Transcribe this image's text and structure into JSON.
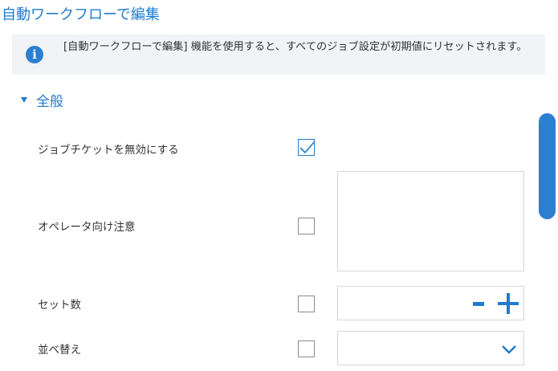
{
  "header": {
    "title": "自動ワークフローで編集"
  },
  "info": {
    "icon": "info-icon",
    "glyph": "i",
    "message": "[自動ワークフローで編集] 機能を使用すると、すべてのジョブ設定が初期値にリセットされます。"
  },
  "section": {
    "label": "全般",
    "expanded": true
  },
  "rows": {
    "disable_ticket": {
      "label": "ジョブチケットを無効にする",
      "checked": true
    },
    "operator_note": {
      "label": "オペレータ向け注意",
      "checked": false,
      "value": ""
    },
    "set_count": {
      "label": "セット数",
      "checked": false,
      "value": ""
    },
    "sort": {
      "label": "並べ替え",
      "checked": false,
      "selected": ""
    }
  },
  "colors": {
    "accent": "#1f7ccf",
    "info_background": "#f1f3f7",
    "text": "#333333",
    "border": "#d6d6d6"
  }
}
